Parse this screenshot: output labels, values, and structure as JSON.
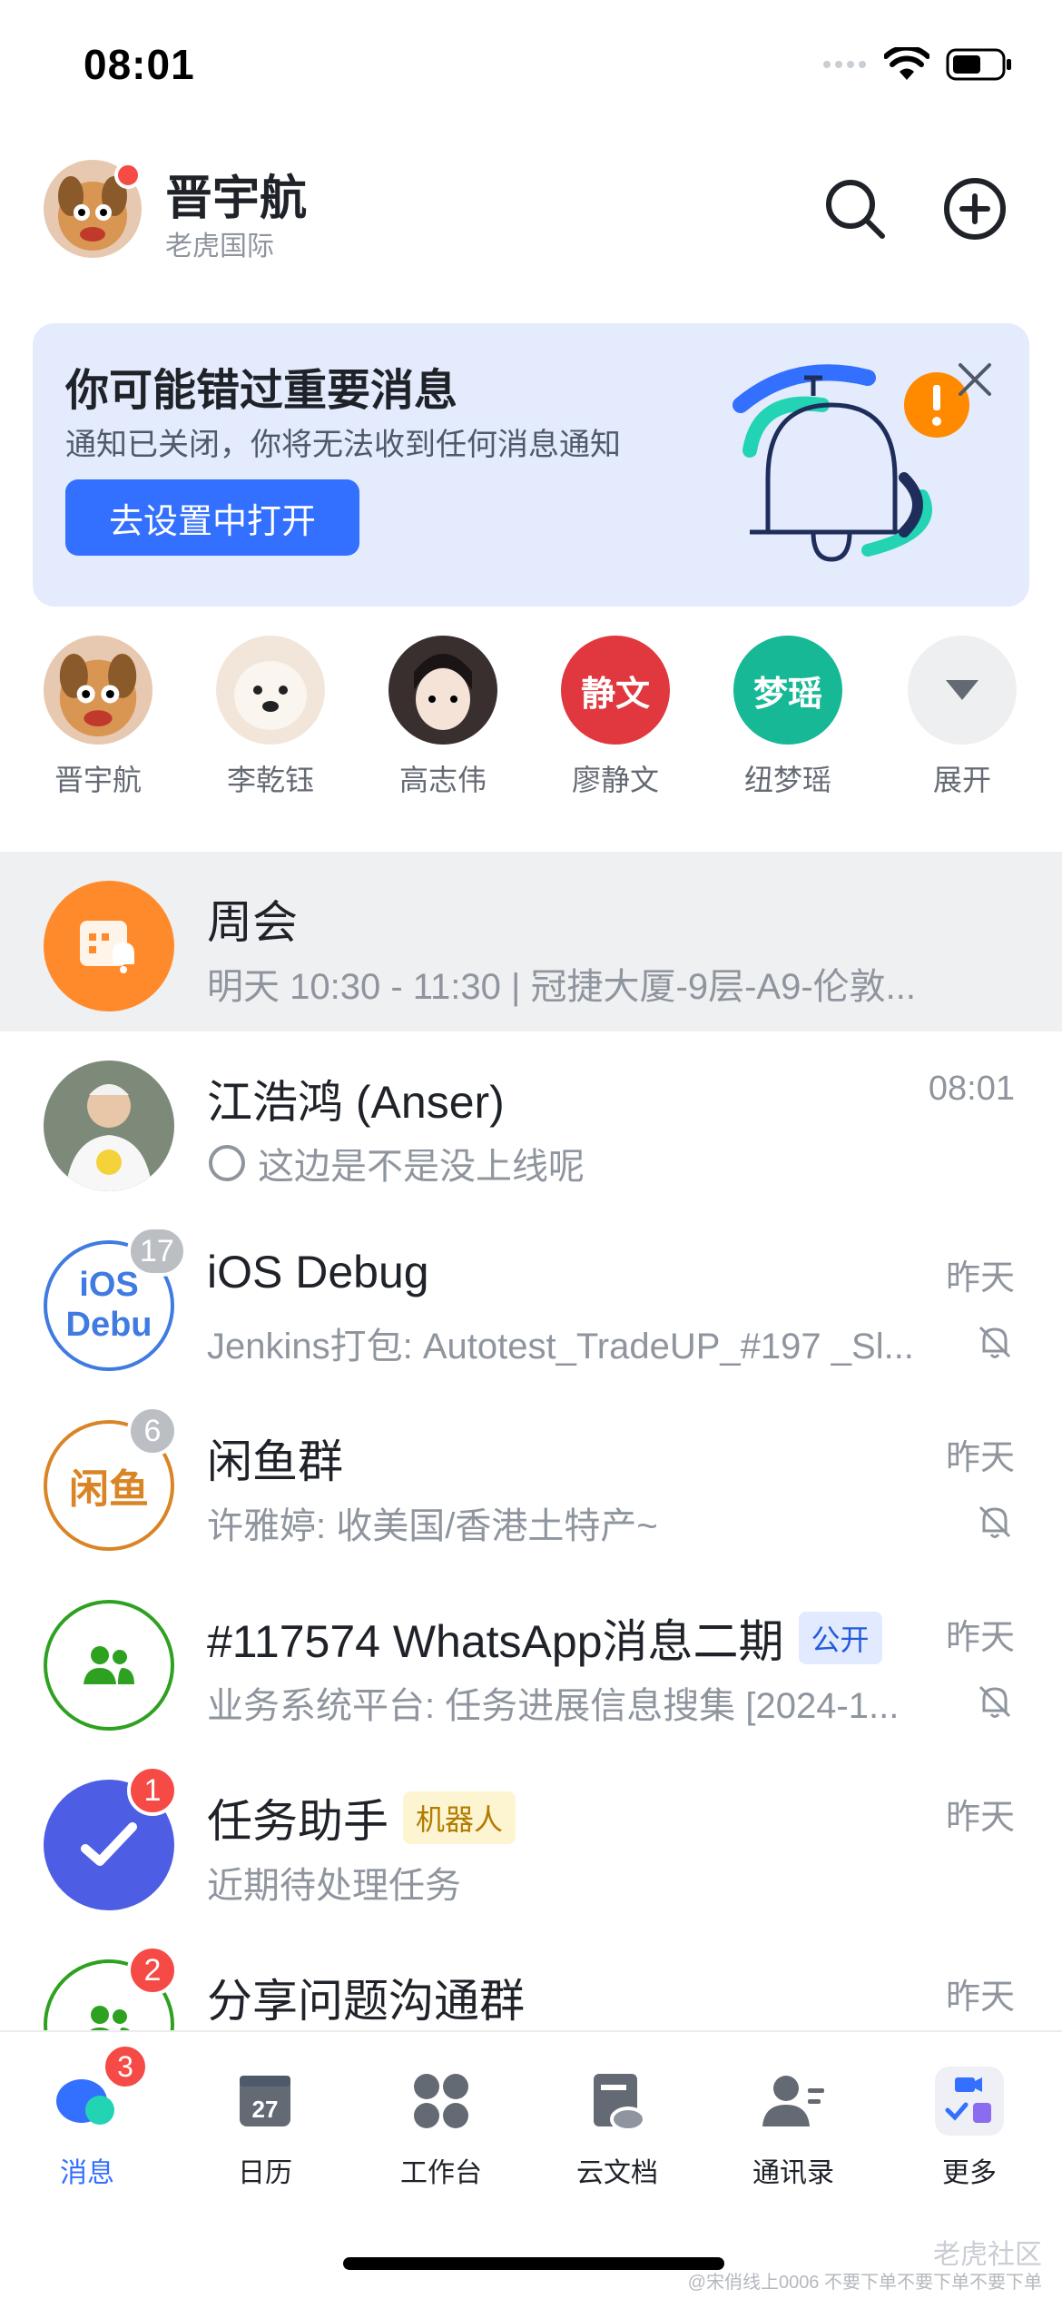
{
  "status_bar": {
    "time": "08:01"
  },
  "header": {
    "user_name": "晋宇航",
    "org_name": "老虎国际"
  },
  "banner": {
    "title": "你可能错过重要消息",
    "subtitle": "通知已关闭，你将无法收到任何消息通知",
    "button_label": "去设置中打开"
  },
  "contacts": [
    {
      "name": "晋宇航",
      "avatar_text": "",
      "color": "#e9a15a"
    },
    {
      "name": "李乾钰",
      "avatar_text": "",
      "color": "#f2e6da"
    },
    {
      "name": "高志伟",
      "avatar_text": "",
      "color": "#3a2f2f"
    },
    {
      "name": "廖静文",
      "avatar_text": "静文",
      "color": "#e0383e"
    },
    {
      "name": "纽梦瑶",
      "avatar_text": "梦瑶",
      "color": "#16b896"
    },
    {
      "name": "展开",
      "avatar_text": "",
      "color": "#eeeff0"
    }
  ],
  "chats": [
    {
      "title": "周会",
      "subtitle": "明天 10:30 - 11:30 | 冠捷大厦-9层-A9-伦敦...",
      "time": "",
      "badge": "",
      "tag": "",
      "muted": false,
      "highlight": true,
      "avatar_color": "#ff8a2b",
      "avatar_text": ""
    },
    {
      "title": "江浩鸿 (Anser)",
      "subtitle": "这边是不是没上线呢",
      "time": "08:01",
      "badge": "",
      "tag": "",
      "muted": false,
      "highlight": false,
      "avatar_color": "#cfd6db",
      "avatar_text": ""
    },
    {
      "title": "iOS Debug",
      "subtitle": "Jenkins打包: Autotest_TradeUP_#197 _Sl...",
      "time": "昨天",
      "badge": "17",
      "tag": "",
      "muted": true,
      "highlight": false,
      "avatar_color": "#3f7be0",
      "avatar_text": "iOS Debu"
    },
    {
      "title": "闲鱼群",
      "subtitle": "许雅婷: 收美国/香港土特产~",
      "time": "昨天",
      "badge": "6",
      "tag": "",
      "muted": true,
      "highlight": false,
      "avatar_color": "#d98526",
      "avatar_text": "闲鱼"
    },
    {
      "title": "#117574 WhatsApp消息二期",
      "subtitle": "业务系统平台: 任务进展信息搜集 [2024-1...",
      "time": "昨天",
      "badge": "",
      "tag": "公开",
      "muted": true,
      "highlight": false,
      "avatar_color": "#2ea121",
      "avatar_text": ""
    },
    {
      "title": "任务助手",
      "subtitle": "近期待处理任务",
      "time": "昨天",
      "badge": "1",
      "tag": "机器人",
      "muted": false,
      "highlight": false,
      "avatar_color": "#4e5ee4",
      "avatar_text": ""
    },
    {
      "title": "分享问题沟通群",
      "subtitle": "",
      "time": "昨天",
      "badge": "2",
      "tag": "",
      "muted": false,
      "highlight": false,
      "avatar_color": "#2ea121",
      "avatar_text": ""
    }
  ],
  "tabs": [
    {
      "label": "消息",
      "badge": "3",
      "active": true
    },
    {
      "label": "日历",
      "badge": "",
      "active": false,
      "icon_text": "27"
    },
    {
      "label": "工作台",
      "badge": "",
      "active": false
    },
    {
      "label": "云文档",
      "badge": "",
      "active": false
    },
    {
      "label": "通讯录",
      "badge": "",
      "active": false
    },
    {
      "label": "更多",
      "badge": "",
      "active": false
    }
  ],
  "watermark": {
    "brand": "老虎社区",
    "footer": "@宋俏线上0006 不要下单不要下单不要下单"
  }
}
